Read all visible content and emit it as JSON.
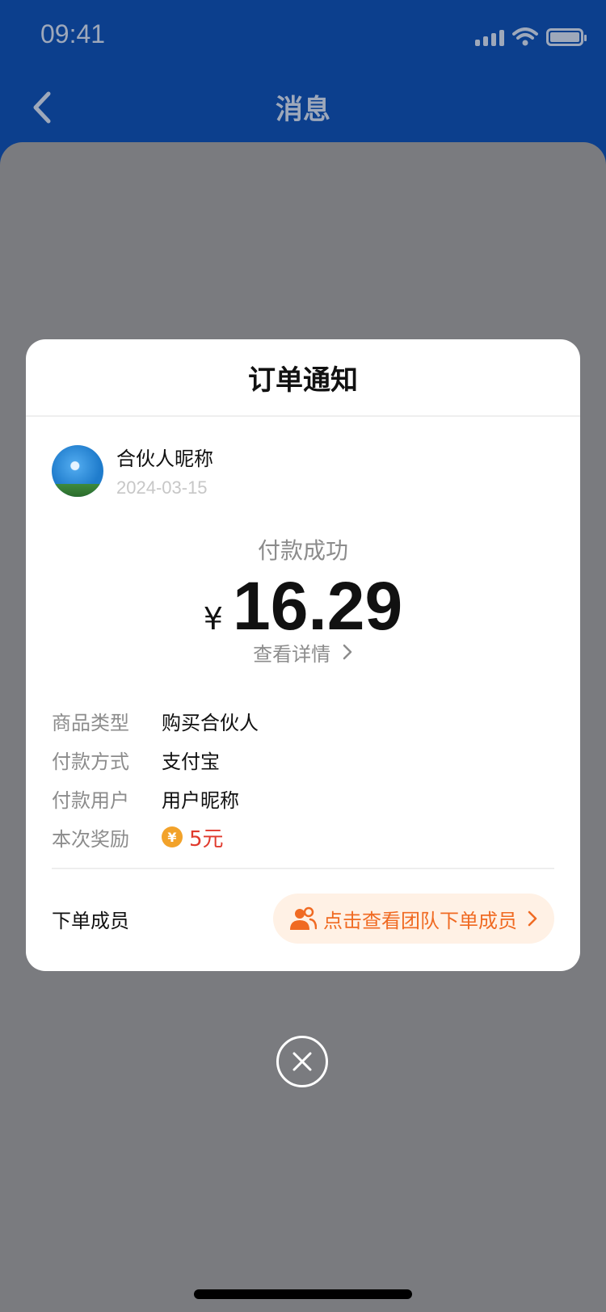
{
  "status_bar": {
    "time": "09:41",
    "icons": [
      "cellular-signal-icon",
      "wifi-icon",
      "battery-icon"
    ]
  },
  "header": {
    "title": "消息",
    "back_icon": "chevron-left-icon"
  },
  "modal": {
    "title": "订单通知",
    "user": {
      "nickname": "合伙人昵称",
      "date": "2024-03-15"
    },
    "payment": {
      "status": "付款成功",
      "currency": "¥",
      "amount": "16.29",
      "detail_link": "查看详情",
      "detail_icon": "chevron-right-icon"
    },
    "info": {
      "rows": [
        {
          "label": "商品类型",
          "value": "购买合伙人"
        },
        {
          "label": "付款方式",
          "value": "支付宝"
        },
        {
          "label": "付款用户",
          "value": "用户昵称"
        },
        {
          "label": "本次奖励",
          "value": "5元",
          "icon": "coin-icon",
          "icon_glyph": "¥"
        }
      ]
    },
    "members": {
      "label": "下单成员",
      "button_label": "点击查看团队下单成员",
      "button_icon": "users-icon",
      "chevron_icon": "chevron-right-icon"
    }
  },
  "close_button": {
    "icon": "close-icon"
  },
  "colors": {
    "header_bg": "#0c3f8d",
    "overlay_bg": "#7a7b7f",
    "modal_bg": "#ffffff",
    "accent_orange": "#f06a22",
    "reward_red": "#e03a2d",
    "coin_gold": "#f2a22a",
    "pill_bg": "#fff1e5"
  }
}
